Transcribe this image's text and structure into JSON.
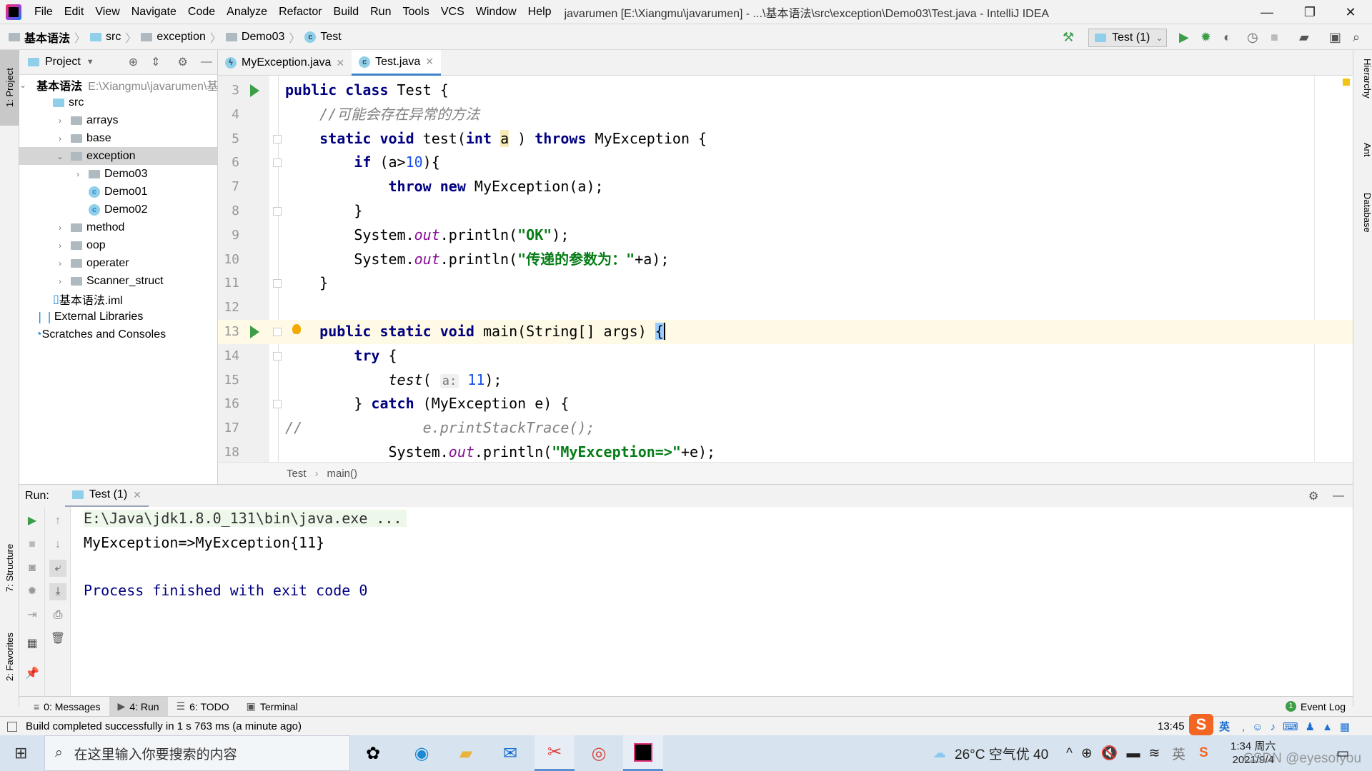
{
  "window": {
    "title": "javarumen [E:\\Xiangmu\\javarumen] - ...\\基本语法\\src\\exception\\Demo03\\Test.java - IntelliJ IDEA",
    "minimize": "—",
    "restore": "❐",
    "close": "✕"
  },
  "menu": [
    "File",
    "Edit",
    "View",
    "Navigate",
    "Code",
    "Analyze",
    "Refactor",
    "Build",
    "Run",
    "Tools",
    "VCS",
    "Window",
    "Help"
  ],
  "breadcrumb": [
    "基本语法",
    "src",
    "exception",
    "Demo03",
    "Test"
  ],
  "toolbar": {
    "run_config": "Test (1)"
  },
  "left_strip": {
    "project": "1: Project",
    "structure": "7: Structure",
    "favorites": "2: Favorites"
  },
  "right_strip": {
    "hierarchy": "Hierarchy",
    "ant": "Ant",
    "database": "Database"
  },
  "project": {
    "header": "Project",
    "tree": [
      {
        "label": "基本语法",
        "path": "E:\\Xiangmu\\javarumen\\基本",
        "level": 0,
        "icon": "module",
        "arrow": "⌄",
        "bold": true
      },
      {
        "label": "src",
        "level": 1,
        "icon": "source-folder",
        "arrow": ""
      },
      {
        "label": "arrays",
        "level": 2,
        "icon": "package",
        "arrow": "›"
      },
      {
        "label": "base",
        "level": 2,
        "icon": "package",
        "arrow": "›"
      },
      {
        "label": "exception",
        "level": 2,
        "icon": "package",
        "arrow": "⌄",
        "selected": true
      },
      {
        "label": "Demo03",
        "level": 3,
        "icon": "package",
        "arrow": "›"
      },
      {
        "label": "Demo01",
        "level": 3,
        "icon": "class",
        "arrow": " "
      },
      {
        "label": "Demo02",
        "level": 3,
        "icon": "class",
        "arrow": " "
      },
      {
        "label": "method",
        "level": 2,
        "icon": "package",
        "arrow": "›"
      },
      {
        "label": "oop",
        "level": 2,
        "icon": "package",
        "arrow": "›"
      },
      {
        "label": "operater",
        "level": 2,
        "icon": "package",
        "arrow": "›"
      },
      {
        "label": "Scanner_struct",
        "level": 2,
        "icon": "package",
        "arrow": "›"
      },
      {
        "label": "基本语法.iml",
        "level": 1,
        "icon": "iml-file",
        "arrow": ""
      },
      {
        "label": "External Libraries",
        "level": 0,
        "icon": "libraries",
        "arrow": ""
      },
      {
        "label": "Scratches and Consoles",
        "level": 0,
        "icon": "scratches",
        "arrow": ""
      }
    ]
  },
  "editor": {
    "tabs": [
      {
        "label": "MyException.java",
        "active": false
      },
      {
        "label": "Test.java",
        "active": true
      }
    ],
    "lines": [
      {
        "n": "3",
        "run": true,
        "tokens": [
          [
            "kw",
            "public class "
          ],
          [
            "",
            "Test {"
          ]
        ]
      },
      {
        "n": "4",
        "tokens": [
          [
            "cm",
            "    //可能会存在异常的方法"
          ]
        ]
      },
      {
        "n": "5",
        "fold": true,
        "tokens": [
          [
            "",
            "    "
          ],
          [
            "kw",
            "static void "
          ],
          [
            "",
            "test("
          ],
          [
            "kw",
            "int "
          ],
          [
            "hl",
            "a"
          ],
          [
            "",
            " ) "
          ],
          [
            "kw",
            "throws "
          ],
          [
            "",
            "MyException {"
          ]
        ]
      },
      {
        "n": "6",
        "fold": true,
        "tokens": [
          [
            "",
            "        "
          ],
          [
            "kw",
            "if "
          ],
          [
            "",
            "(a>"
          ],
          [
            "num",
            "10"
          ],
          [
            "",
            "){"
          ]
        ]
      },
      {
        "n": "7",
        "tokens": [
          [
            "",
            "            "
          ],
          [
            "kw",
            "throw new "
          ],
          [
            "",
            "MyException(a);"
          ]
        ]
      },
      {
        "n": "8",
        "fold": true,
        "tokens": [
          [
            "",
            "        }"
          ]
        ]
      },
      {
        "n": "9",
        "tokens": [
          [
            "",
            "        System."
          ],
          [
            "fld",
            "out"
          ],
          [
            "",
            ".println("
          ],
          [
            "str",
            "\"OK\""
          ],
          [
            "",
            ");"
          ]
        ]
      },
      {
        "n": "10",
        "tokens": [
          [
            "",
            "        System."
          ],
          [
            "fld",
            "out"
          ],
          [
            "",
            ".println("
          ],
          [
            "str",
            "\"传递的参数为：\""
          ],
          [
            "",
            "+a);"
          ]
        ]
      },
      {
        "n": "11",
        "fold": true,
        "tokens": [
          [
            "",
            "    }"
          ]
        ]
      },
      {
        "n": "12",
        "tokens": []
      },
      {
        "n": "13",
        "run": true,
        "fold": true,
        "bulb": true,
        "current": true,
        "tokens": [
          [
            "",
            "    "
          ],
          [
            "kw",
            "public static void "
          ],
          [
            "",
            "main(String[] args) "
          ],
          [
            "brace",
            "{"
          ]
        ]
      },
      {
        "n": "14",
        "fold": true,
        "tokens": [
          [
            "",
            "        "
          ],
          [
            "kw",
            "try "
          ],
          [
            "",
            "{"
          ]
        ]
      },
      {
        "n": "15",
        "tokens": [
          [
            "",
            "            "
          ],
          [
            "it",
            "test"
          ],
          [
            "",
            "( "
          ],
          [
            "hint",
            "a:"
          ],
          [
            "num",
            " 11"
          ],
          [
            "",
            ");"
          ]
        ]
      },
      {
        "n": "16",
        "fold": true,
        "tokens": [
          [
            "",
            "        } "
          ],
          [
            "kw",
            "catch "
          ],
          [
            "",
            "(MyException e) {"
          ]
        ]
      },
      {
        "n": "17",
        "tokens": [
          [
            "cm",
            "//              e.printStackTrace();"
          ]
        ]
      },
      {
        "n": "18",
        "tokens": [
          [
            "",
            "            System."
          ],
          [
            "fld",
            "out"
          ],
          [
            "",
            ".println("
          ],
          [
            "str",
            "\"MyException=>\""
          ],
          [
            "",
            "+e);"
          ]
        ]
      }
    ],
    "breadcrumb": [
      "Test",
      "main()"
    ]
  },
  "run": {
    "label": "Run:",
    "tab": "Test (1)",
    "output": [
      {
        "text": "E:\\Java\\jdk1.8.0_131\\bin\\java.exe ...",
        "type": "cmd"
      },
      {
        "text": "MyException=>MyException{11}",
        "type": "out"
      },
      {
        "text": "",
        "type": "out"
      },
      {
        "text": "Process finished with exit code 0",
        "type": "proc"
      }
    ]
  },
  "bottom_tabs": [
    {
      "label": "0: Messages",
      "icon": "≡"
    },
    {
      "label": "4: Run",
      "icon": "▶",
      "active": true
    },
    {
      "label": "6: TODO",
      "icon": "☰"
    },
    {
      "label": "Terminal",
      "icon": "▣"
    }
  ],
  "event_log": {
    "badge": "1",
    "label": "Event Log"
  },
  "status": {
    "message": "Build completed successfully in 1 s 763 ms (a minute ago)",
    "time": "13:45",
    "ime": "英"
  },
  "taskbar": {
    "search_placeholder": "在这里输入你要搜索的内容",
    "weather": "26°C  空气优 40",
    "ime": "英",
    "clock_time": "1:34 周六",
    "clock_date": "2021/9/4",
    "watermark": "CSDN @eyesofyou"
  },
  "colors": {
    "keyword": "#000080",
    "string": "#067d17",
    "number": "#1750eb",
    "field": "#871094",
    "comment": "#808080",
    "accent": "#4083c9",
    "run_green": "#3d9e48"
  }
}
